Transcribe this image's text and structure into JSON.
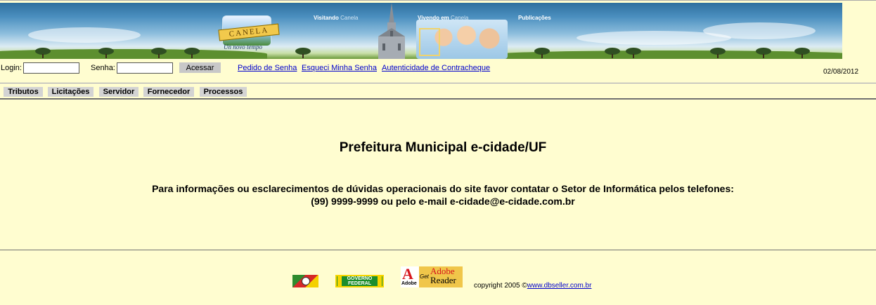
{
  "banner": {
    "logo_text": "CANELA",
    "slogan": "Un novo tempo",
    "nav": [
      {
        "label": "Visitando",
        "faint": "Canela"
      },
      {
        "label": "Vivendo em",
        "faint": "Canela"
      },
      {
        "label": "Publicações",
        "faint": ""
      }
    ]
  },
  "login": {
    "login_label": "Login:",
    "login_value": "",
    "password_label": "Senha:",
    "password_value": "",
    "submit_label": "Acessar",
    "links": [
      "Pedido de Senha",
      "Esqueci Minha Senha",
      "Autenticidade de Contracheque"
    ],
    "date": "02/08/2012"
  },
  "menu": [
    "Tributos",
    "Licitações",
    "Servidor",
    "Fornecedor",
    "Processos"
  ],
  "main": {
    "title": "Prefeitura Municipal e-cidade/UF",
    "info_line1": "Para informações ou esclarecimentos de dúvidas operacionais do site favor contatar o Setor de Informática pelos telefones:",
    "info_line2": "(99) 9999-9999 ou pelo e-mail e-cidade@e-cidade.com.br"
  },
  "footer": {
    "gov_text": "GOVERNO FEDERAL",
    "adobe_small": "Adobe",
    "adobe_get": "Get",
    "adobe_product1": "Adobe",
    "adobe_product2": "Reader",
    "copyright_text": "copyright 2005 ©",
    "copyright_link": "www.dbseller.com.br"
  },
  "colors": {
    "page_background": "#fffdd0",
    "link": "#0000cc",
    "menu_button": "#d3d3d3"
  }
}
